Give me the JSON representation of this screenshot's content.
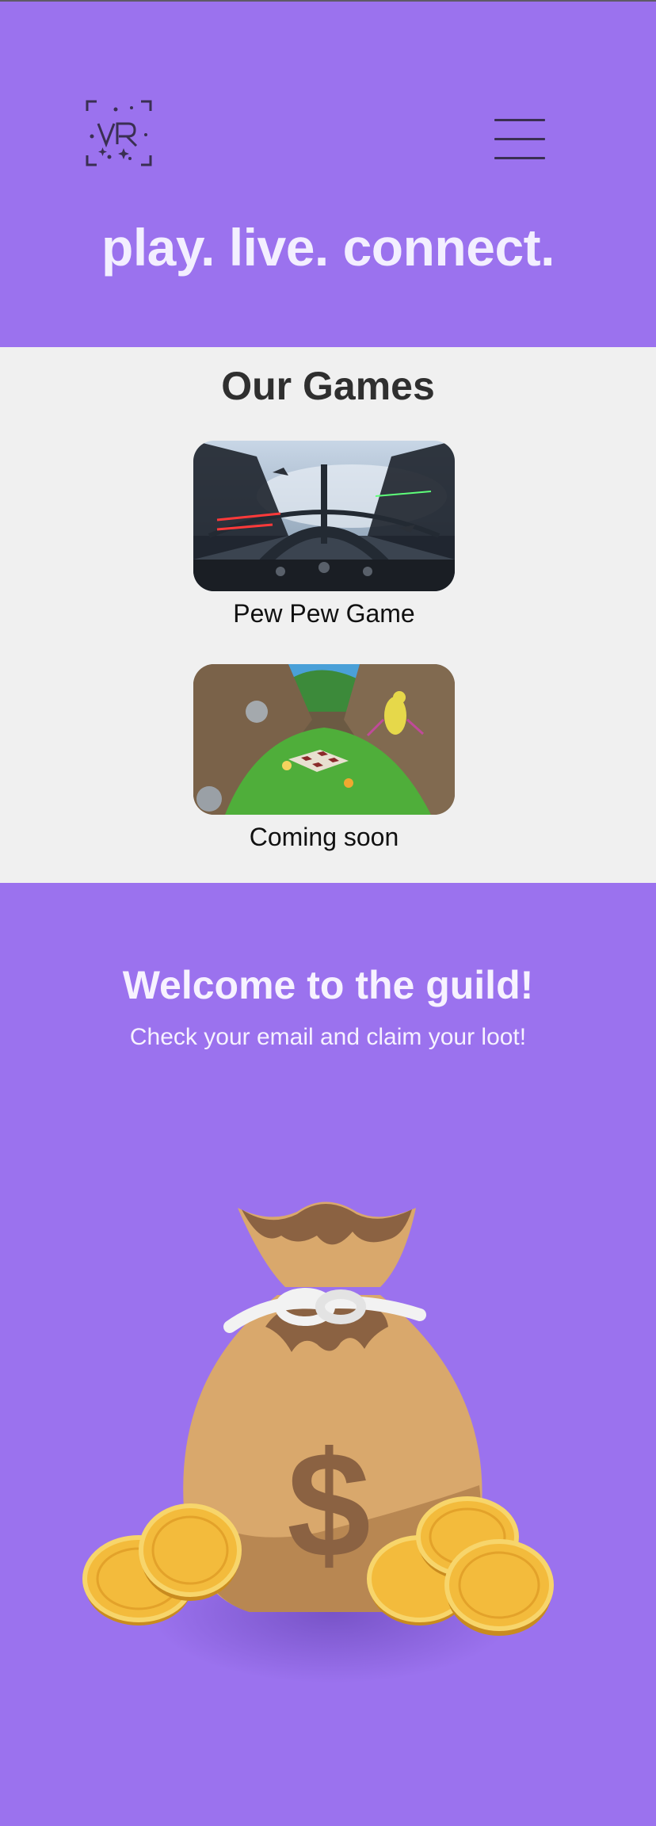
{
  "hero": {
    "tagline": "play. live. connect.",
    "logo_icon": "vr-logo-icon",
    "menu_icon": "hamburger-menu-icon"
  },
  "games": {
    "title": "Our Games",
    "items": [
      {
        "name": "Pew Pew Game",
        "thumbnail": "space-cockpit-image"
      },
      {
        "name": "Coming soon",
        "thumbnail": "forest-canyon-image"
      }
    ]
  },
  "welcome": {
    "title": "Welcome to the guild!",
    "subtitle": "Check your email and claim your loot!",
    "illustration": "money-bag-with-coins-image"
  },
  "colors": {
    "primary": "#9b72ee",
    "light_bg": "#f0f0f0",
    "text_dark": "#2f2f2f",
    "coin": "#f0b63a",
    "bag": "#d2a36a"
  }
}
